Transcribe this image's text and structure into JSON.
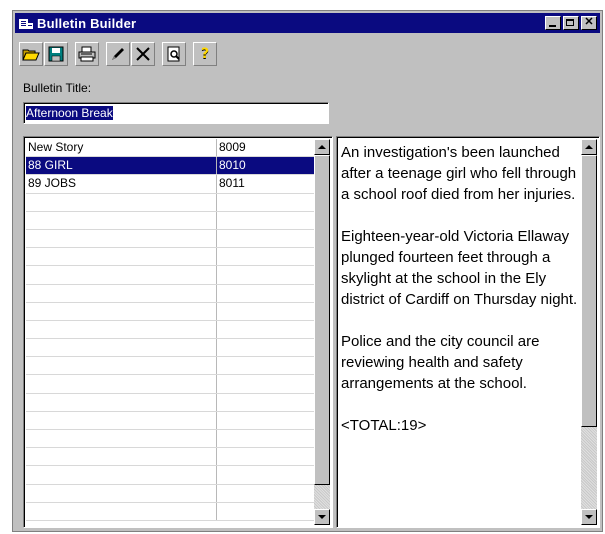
{
  "window": {
    "title": "Bulletin Builder"
  },
  "toolbar": {
    "buttons": [
      {
        "icon": "open-folder-icon"
      },
      {
        "icon": "save-icon"
      },
      {
        "icon": "print-icon"
      },
      {
        "icon": "edit-pencil-icon"
      },
      {
        "icon": "delete-x-icon"
      },
      {
        "icon": "print-preview-icon"
      },
      {
        "icon": "help-icon"
      }
    ]
  },
  "bulletin": {
    "label": "Bulletin Title:",
    "value": "Afternoon Break"
  },
  "stories": [
    {
      "name": "New Story",
      "id": "8009",
      "selected": false
    },
    {
      "name": "88 GIRL",
      "id": "8010",
      "selected": true
    },
    {
      "name": "89 JOBS",
      "id": "8011",
      "selected": false
    }
  ],
  "story_text": {
    "paragraphs": [
      "An investigation's been launched after a teenage girl who fell through a school roof died from her injuries.",
      "Eighteen-year-old Victoria Ellaway plunged fourteen feet through a skylight at the school in the Ely district of Cardiff on Thursday night.",
      "Police and the city council are reviewing health and safety arrangements at the school.",
      "<TOTAL:19>"
    ]
  },
  "colors": {
    "titlebar": "#0a0a80",
    "selection": "#0a0a80",
    "face": "#c0c0c0"
  }
}
